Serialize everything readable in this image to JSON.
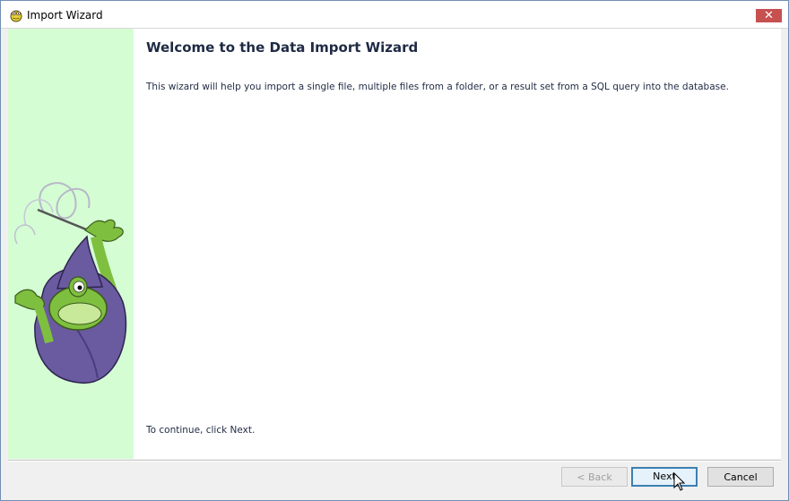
{
  "window": {
    "title": "Import Wizard",
    "close_label": "✕"
  },
  "content": {
    "heading": "Welcome to the Data Import Wizard",
    "description": "This wizard will help you import a single file, multiple files from a folder,  or a result set from a SQL query into the database.",
    "continue_hint": "To continue, click Next."
  },
  "buttons": {
    "back": "< Back",
    "next": "Next",
    "cancel": "Cancel"
  },
  "colors": {
    "side_panel": "#d4fdd4",
    "close_button": "#c75050",
    "focused_button_border": "#3c7fb1"
  },
  "icons": {
    "app": "toad-icon",
    "illustration": "wizard-frog-illustration"
  }
}
